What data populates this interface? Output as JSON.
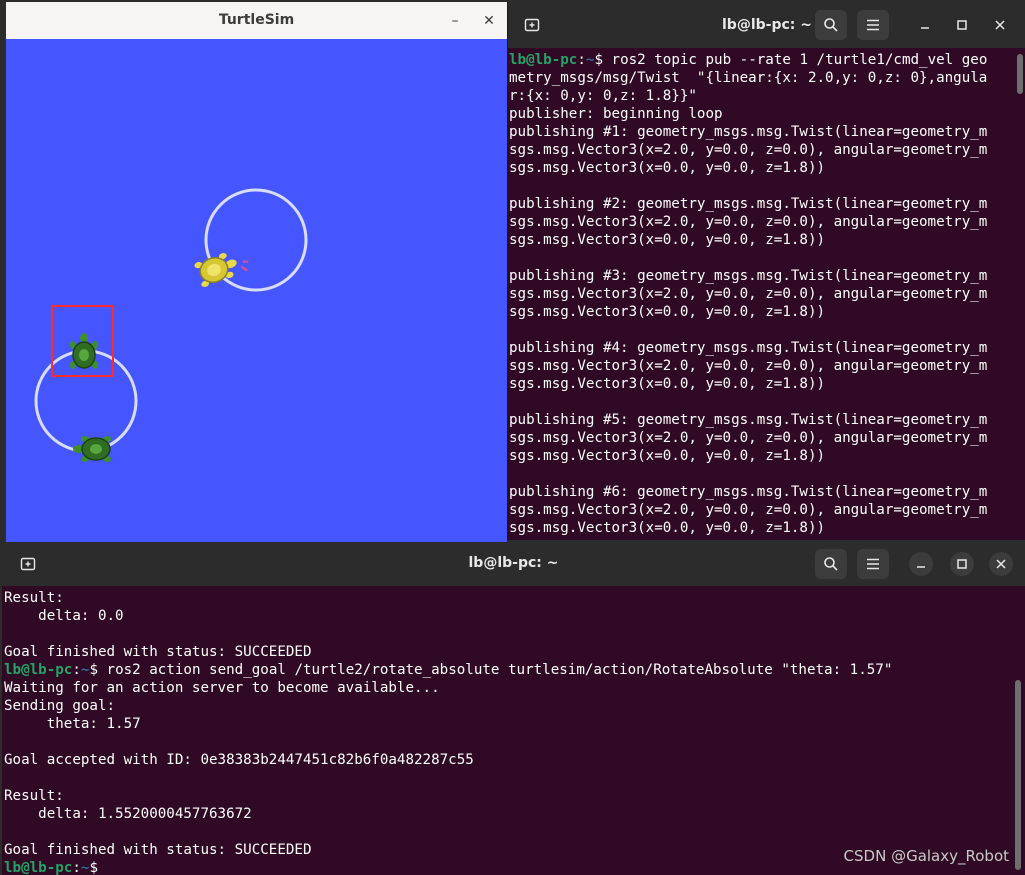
{
  "turtlesim": {
    "title": "TurtleSim",
    "minimize_glyph": "–",
    "close_glyph": "✕",
    "background_color": "#4556ff"
  },
  "term_top": {
    "title": "lb@lb-pc: ~",
    "prompt_user": "lb@lb-pc",
    "prompt_sep": ":",
    "prompt_path": "~",
    "prompt_dollar": "$ ",
    "lines": [
      "ros2 topic pub --rate 1 /turtle1/cmd_vel geo",
      "metry_msgs/msg/Twist  \"{linear:{x: 2.0,y: 0,z: 0},angula",
      "r:{x: 0,y: 0,z: 1.8}}\"",
      "publisher: beginning loop",
      "publishing #1: geometry_msgs.msg.Twist(linear=geometry_m",
      "sgs.msg.Vector3(x=2.0, y=0.0, z=0.0), angular=geometry_m",
      "sgs.msg.Vector3(x=0.0, y=0.0, z=1.8))",
      "",
      "publishing #2: geometry_msgs.msg.Twist(linear=geometry_m",
      "sgs.msg.Vector3(x=2.0, y=0.0, z=0.0), angular=geometry_m",
      "sgs.msg.Vector3(x=0.0, y=0.0, z=1.8))",
      "",
      "publishing #3: geometry_msgs.msg.Twist(linear=geometry_m",
      "sgs.msg.Vector3(x=2.0, y=0.0, z=0.0), angular=geometry_m",
      "sgs.msg.Vector3(x=0.0, y=0.0, z=1.8))",
      "",
      "publishing #4: geometry_msgs.msg.Twist(linear=geometry_m",
      "sgs.msg.Vector3(x=2.0, y=0.0, z=0.0), angular=geometry_m",
      "sgs.msg.Vector3(x=0.0, y=0.0, z=1.8))",
      "",
      "publishing #5: geometry_msgs.msg.Twist(linear=geometry_m",
      "sgs.msg.Vector3(x=2.0, y=0.0, z=0.0), angular=geometry_m",
      "sgs.msg.Vector3(x=0.0, y=0.0, z=1.8))",
      "",
      "publishing #6: geometry_msgs.msg.Twist(linear=geometry_m",
      "sgs.msg.Vector3(x=2.0, y=0.0, z=0.0), angular=geometry_m",
      "sgs.msg.Vector3(x=0.0, y=0.0, z=1.8))"
    ]
  },
  "term_bottom": {
    "title": "lb@lb-pc: ~",
    "prompt_user": "lb@lb-pc",
    "prompt_sep": ":",
    "prompt_path": "~",
    "prompt_dollar": "$ ",
    "lines": [
      "Result:",
      "    delta: 0.0",
      "",
      "Goal finished with status: SUCCEEDED",
      "ros2 action send_goal /turtle2/rotate_absolute turtlesim/action/RotateAbsolute \"theta: 1.57\"",
      "Waiting for an action server to become available...",
      "Sending goal:",
      "     theta: 1.57",
      "",
      "Goal accepted with ID: 0e38383b2447451c82b6f0a482287c55",
      "",
      "Result:",
      "    delta: 1.5520000457763672",
      "",
      "Goal finished with status: SUCCEEDED",
      ""
    ],
    "prompt_line_indices": [
      4,
      15
    ]
  },
  "icons": {
    "new_tab": "new-tab-icon",
    "search": "search-icon",
    "menu": "hamburger-menu-icon",
    "minimize": "minimize-icon",
    "maximize": "maximize-icon",
    "close": "close-icon"
  },
  "watermark": "CSDN @Galaxy_Robot"
}
